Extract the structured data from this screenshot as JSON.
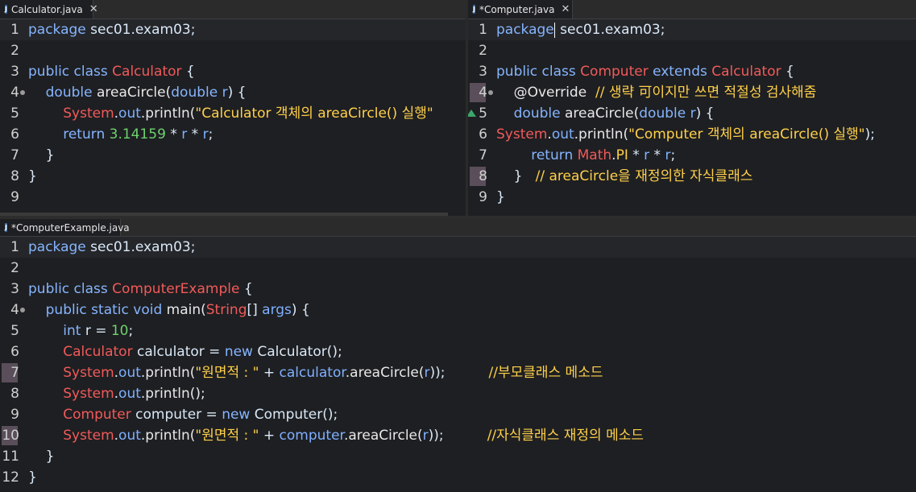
{
  "panes": {
    "left": {
      "tab": {
        "title": "Calculator.java",
        "close": "✕"
      },
      "lines": [
        {
          "n": "1",
          "segments": [
            {
              "t": "package",
              "c": "kw"
            },
            {
              "t": " sec01.exam03;",
              "c": "pl"
            }
          ]
        },
        {
          "n": "2",
          "segments": []
        },
        {
          "n": "3",
          "segments": [
            {
              "t": "public class ",
              "c": "kw"
            },
            {
              "t": "Calculator",
              "c": "cls"
            },
            {
              "t": " {",
              "c": "pl"
            }
          ]
        },
        {
          "n": "4",
          "segments": [
            {
              "t": "    ",
              "c": "pl"
            },
            {
              "t": "double ",
              "c": "kw"
            },
            {
              "t": "areaCircle(",
              "c": "fn"
            },
            {
              "t": "double ",
              "c": "kw"
            },
            {
              "t": "r",
              "c": "var"
            },
            {
              "t": ") {",
              "c": "pl"
            }
          ]
        },
        {
          "n": "5",
          "segments": [
            {
              "t": "        ",
              "c": "pl"
            },
            {
              "t": "System",
              "c": "cls"
            },
            {
              "t": ".",
              "c": "pl"
            },
            {
              "t": "out",
              "c": "var"
            },
            {
              "t": ".println(",
              "c": "fn"
            },
            {
              "t": "\"Calculator 객체의 areaCircle() 실행\"",
              "c": "str"
            }
          ]
        },
        {
          "n": "6",
          "segments": [
            {
              "t": "        ",
              "c": "pl"
            },
            {
              "t": "return ",
              "c": "kw"
            },
            {
              "t": "3.14159",
              "c": "num"
            },
            {
              "t": " * ",
              "c": "pl"
            },
            {
              "t": "r",
              "c": "var"
            },
            {
              "t": " * ",
              "c": "pl"
            },
            {
              "t": "r",
              "c": "var"
            },
            {
              "t": ";",
              "c": "pl"
            }
          ]
        },
        {
          "n": "7",
          "segments": [
            {
              "t": "    }",
              "c": "pl"
            }
          ]
        },
        {
          "n": "8",
          "segments": [
            {
              "t": "}",
              "c": "pl"
            }
          ]
        },
        {
          "n": "9",
          "segments": []
        }
      ]
    },
    "right": {
      "tab": {
        "title": "*Computer.java",
        "close": "✕"
      },
      "lines": [
        {
          "n": "1",
          "segments": [
            {
              "t": "package",
              "c": "kw"
            },
            {
              "t": "caret",
              "c": "caret"
            },
            {
              "t": " sec01.exam03;",
              "c": "pl"
            }
          ]
        },
        {
          "n": "2",
          "segments": []
        },
        {
          "n": "3",
          "segments": [
            {
              "t": "public class ",
              "c": "kw"
            },
            {
              "t": "Computer",
              "c": "cls"
            },
            {
              "t": " extends ",
              "c": "kw"
            },
            {
              "t": "Calculator",
              "c": "cls"
            },
            {
              "t": " {",
              "c": "pl"
            }
          ]
        },
        {
          "n": "4",
          "segments": [
            {
              "t": "    @Override  ",
              "c": "fn"
            },
            {
              "t": "// 생략 可이지만 쓰면 적절성 검사해줌",
              "c": "cmt"
            }
          ]
        },
        {
          "n": "5",
          "segments": [
            {
              "t": "    ",
              "c": "pl"
            },
            {
              "t": "double ",
              "c": "kw"
            },
            {
              "t": "areaCircle(",
              "c": "fn"
            },
            {
              "t": "double ",
              "c": "kw"
            },
            {
              "t": "r",
              "c": "var"
            },
            {
              "t": ") {",
              "c": "pl"
            }
          ]
        },
        {
          "n": "6",
          "segments": [
            {
              "t": "System",
              "c": "cls"
            },
            {
              "t": ".",
              "c": "pl"
            },
            {
              "t": "out",
              "c": "var"
            },
            {
              "t": ".println(",
              "c": "fn"
            },
            {
              "t": "\"Computer 객체의 areaCircle() 실행\"",
              "c": "str"
            },
            {
              "t": ");",
              "c": "pl"
            }
          ]
        },
        {
          "n": "7",
          "segments": [
            {
              "t": "        ",
              "c": "pl"
            },
            {
              "t": "return ",
              "c": "kw"
            },
            {
              "t": "Math",
              "c": "cls"
            },
            {
              "t": ".",
              "c": "pl"
            },
            {
              "t": "PI",
              "c": "str"
            },
            {
              "t": " * ",
              "c": "pl"
            },
            {
              "t": "r",
              "c": "var"
            },
            {
              "t": " * ",
              "c": "pl"
            },
            {
              "t": "r",
              "c": "var"
            },
            {
              "t": ";",
              "c": "pl"
            }
          ]
        },
        {
          "n": "8",
          "segments": [
            {
              "t": "    }   ",
              "c": "pl"
            },
            {
              "t": "// areaCircle을 재정의한 자식클래스",
              "c": "cmt"
            }
          ]
        },
        {
          "n": "9",
          "segments": [
            {
              "t": "}",
              "c": "pl"
            }
          ]
        }
      ]
    },
    "bottom": {
      "tab": {
        "title": "*ComputerExample.java"
      },
      "lines": [
        {
          "n": "1",
          "segments": [
            {
              "t": "package",
              "c": "kw"
            },
            {
              "t": " sec01.exam03;",
              "c": "pl"
            }
          ]
        },
        {
          "n": "2",
          "segments": []
        },
        {
          "n": "3",
          "segments": [
            {
              "t": "public class ",
              "c": "kw"
            },
            {
              "t": "ComputerExample",
              "c": "cls"
            },
            {
              "t": " {",
              "c": "pl"
            }
          ]
        },
        {
          "n": "4",
          "segments": [
            {
              "t": "    ",
              "c": "pl"
            },
            {
              "t": "public static void ",
              "c": "kw"
            },
            {
              "t": "main(",
              "c": "fn"
            },
            {
              "t": "String",
              "c": "cls"
            },
            {
              "t": "[] ",
              "c": "pl"
            },
            {
              "t": "args",
              "c": "var"
            },
            {
              "t": ") {",
              "c": "pl"
            }
          ]
        },
        {
          "n": "5",
          "segments": [
            {
              "t": "        ",
              "c": "pl"
            },
            {
              "t": "int ",
              "c": "kw"
            },
            {
              "t": "r = ",
              "c": "pl"
            },
            {
              "t": "10",
              "c": "num"
            },
            {
              "t": ";",
              "c": "pl"
            }
          ]
        },
        {
          "n": "6",
          "segments": [
            {
              "t": "        ",
              "c": "pl"
            },
            {
              "t": "Calculator",
              "c": "cls"
            },
            {
              "t": " calculator = ",
              "c": "pl"
            },
            {
              "t": "new ",
              "c": "kw"
            },
            {
              "t": "Calculator();",
              "c": "pl"
            }
          ]
        },
        {
          "n": "7",
          "segments": [
            {
              "t": "        ",
              "c": "pl"
            },
            {
              "t": "System",
              "c": "cls"
            },
            {
              "t": ".",
              "c": "pl"
            },
            {
              "t": "out",
              "c": "var"
            },
            {
              "t": ".println(",
              "c": "fn"
            },
            {
              "t": "\"원면적 : \"",
              "c": "str"
            },
            {
              "t": " + ",
              "c": "pl"
            },
            {
              "t": "calculator",
              "c": "var"
            },
            {
              "t": ".areaCircle(",
              "c": "fn"
            },
            {
              "t": "r",
              "c": "var"
            },
            {
              "t": "));          ",
              "c": "pl"
            },
            {
              "t": "//부모클래스 메소드",
              "c": "cmt"
            }
          ]
        },
        {
          "n": "8",
          "segments": [
            {
              "t": "        ",
              "c": "pl"
            },
            {
              "t": "System",
              "c": "cls"
            },
            {
              "t": ".",
              "c": "pl"
            },
            {
              "t": "out",
              "c": "var"
            },
            {
              "t": ".println();",
              "c": "fn"
            }
          ]
        },
        {
          "n": "9",
          "segments": [
            {
              "t": "        ",
              "c": "pl"
            },
            {
              "t": "Computer",
              "c": "cls"
            },
            {
              "t": " computer = ",
              "c": "pl"
            },
            {
              "t": "new ",
              "c": "kw"
            },
            {
              "t": "Computer();",
              "c": "pl"
            }
          ]
        },
        {
          "n": "10",
          "segments": [
            {
              "t": "        ",
              "c": "pl"
            },
            {
              "t": "System",
              "c": "cls"
            },
            {
              "t": ".",
              "c": "pl"
            },
            {
              "t": "out",
              "c": "var"
            },
            {
              "t": ".println(",
              "c": "fn"
            },
            {
              "t": "\"원면적 : \"",
              "c": "str"
            },
            {
              "t": " + ",
              "c": "pl"
            },
            {
              "t": "computer",
              "c": "var"
            },
            {
              "t": ".areaCircle(",
              "c": "fn"
            },
            {
              "t": "r",
              "c": "var"
            },
            {
              "t": "));          ",
              "c": "pl"
            },
            {
              "t": "//자식클래스 재정의 메소드",
              "c": "cmt"
            }
          ]
        },
        {
          "n": "11",
          "segments": [
            {
              "t": "    }",
              "c": "pl"
            }
          ]
        },
        {
          "n": "12",
          "segments": [
            {
              "t": "}",
              "c": "pl"
            }
          ]
        }
      ]
    }
  }
}
